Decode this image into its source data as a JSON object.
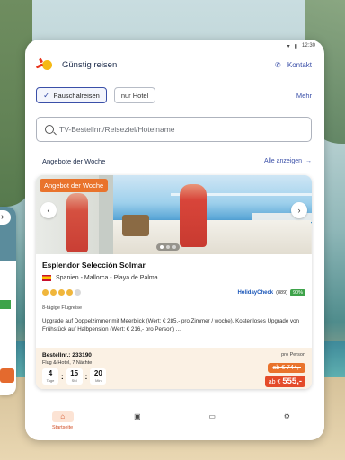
{
  "status_bar": {
    "time": "12:30"
  },
  "header": {
    "brand": "Günstig reisen",
    "contact_label": "Kontakt"
  },
  "filters": {
    "chip_package": "Pauschalreisen",
    "chip_hotel": "nur Hotel",
    "more_label": "Mehr"
  },
  "search": {
    "placeholder": "TV-Bestellnr./Reiseziel/Hotelname"
  },
  "section": {
    "title": "Angebote der Woche",
    "show_all": "Alle anzeigen"
  },
  "offer": {
    "badge": "Angebot der Woche",
    "hotel_name": "Esplendor Selección Solmar",
    "location": "Spanien - Mallorca - Playa de Palma",
    "rating_suns": 4,
    "rating_max": 5,
    "holidaycheck_label": "HolidayCheck",
    "holidaycheck_count": "(889)",
    "holidaycheck_score": "90%",
    "flight_info": "8-tägige Flugreise",
    "description": "Upgrade auf Doppelzimmer mit Meerblick (Wert: € 285,- pro Zimmer / woche), Kostenloses Upgrade von Frühstück auf Halbpension (Wert: € 216,- pro Person) ...",
    "order_number": "Bestellnr.: 233190",
    "package": "Flug & Hotel, 7 Nächte",
    "countdown": [
      {
        "value": "4",
        "unit": "Tage"
      },
      {
        "value": "15",
        "unit": "Std"
      },
      {
        "value": "20",
        "unit": "Min"
      }
    ],
    "per_person": "pro Person",
    "old_price": "ab € 744,-",
    "new_price_prefix": "ab €",
    "new_price": "555,-"
  },
  "tabbar": {
    "home_label": "Startseite"
  },
  "colors": {
    "accent": "#3a4fa8",
    "orange": "#e9732c",
    "green": "#3ea34a"
  }
}
